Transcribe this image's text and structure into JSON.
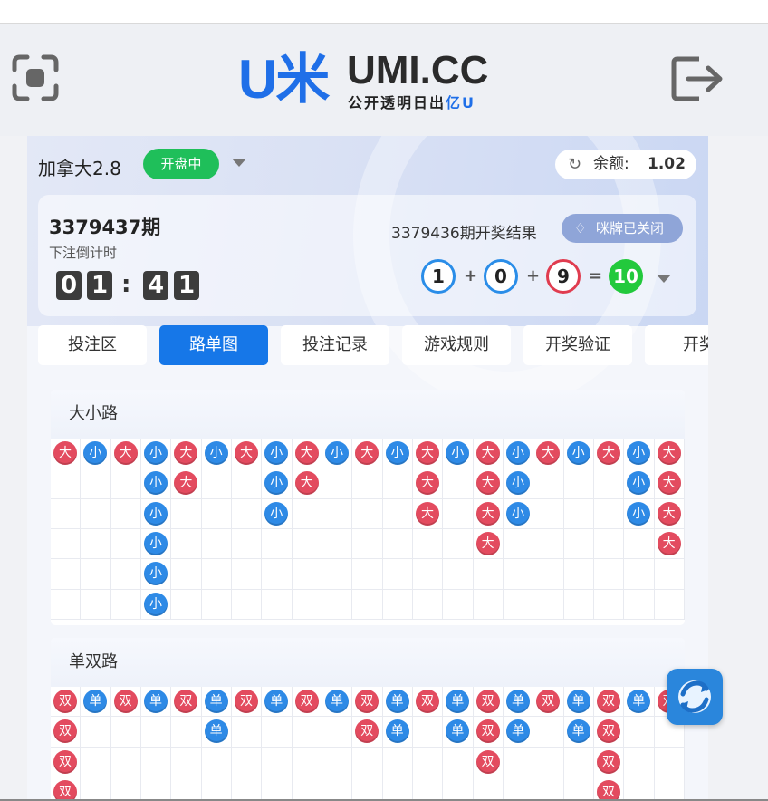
{
  "logo": {
    "mark": "U米",
    "name": "UMI.CC",
    "slogan_main": "公开透明日出",
    "slogan_tail": "亿U"
  },
  "game": {
    "name": "加拿大2.8",
    "status": "开盘中"
  },
  "balance": {
    "label": "余额:",
    "value": "1.02"
  },
  "draw": {
    "current_period": "3379437期",
    "countdown_label": "下注倒计时",
    "countdown_digits": [
      "0",
      "1",
      "4",
      "1"
    ],
    "countdown_sep": ":",
    "last_result_label": "3379436期开奖结果",
    "squeeze_label": "咪牌已关闭",
    "balls": [
      "1",
      "0",
      "9"
    ],
    "sum": "10",
    "ops": [
      "+",
      "+",
      "="
    ]
  },
  "tabs": [
    {
      "label": "投注区",
      "active": false
    },
    {
      "label": "路单图",
      "active": true
    },
    {
      "label": "投注记录",
      "active": false
    },
    {
      "label": "游戏规则",
      "active": false
    },
    {
      "label": "开奖验证",
      "active": false
    },
    {
      "label": "开奖",
      "active": false
    }
  ],
  "colors": {
    "accent": "#1677e8",
    "big_even": "#e34b5f",
    "small_odd": "#2e8ae6",
    "open": "#1fbf5a",
    "sum": "#22c93c"
  },
  "roads": [
    {
      "title": "大小路",
      "rows": 6,
      "columns": [
        [
          "大"
        ],
        [
          "小"
        ],
        [
          "大"
        ],
        [
          "小",
          "小",
          "小",
          "小",
          "小",
          "小"
        ],
        [
          "大",
          "大"
        ],
        [
          "小"
        ],
        [
          "大"
        ],
        [
          "小",
          "小",
          "小"
        ],
        [
          "大",
          "大"
        ],
        [
          "小"
        ],
        [
          "大"
        ],
        [
          "小"
        ],
        [
          "大",
          "大",
          "大"
        ],
        [
          "小"
        ],
        [
          "大",
          "大",
          "大",
          "大"
        ],
        [
          "小",
          "小",
          "小"
        ],
        [
          "大"
        ],
        [
          "小"
        ],
        [
          "大"
        ],
        [
          "小",
          "小",
          "小"
        ],
        [
          "大",
          "大",
          "大",
          "大"
        ]
      ]
    },
    {
      "title": "单双路",
      "rows": 4,
      "columns": [
        [
          "双",
          "双",
          "双",
          "双"
        ],
        [
          "单"
        ],
        [
          "双"
        ],
        [
          "单"
        ],
        [
          "双"
        ],
        [
          "单",
          "单"
        ],
        [
          "双"
        ],
        [
          "单"
        ],
        [
          "双"
        ],
        [
          "单"
        ],
        [
          "双",
          "双"
        ],
        [
          "单",
          "单"
        ],
        [
          "双"
        ],
        [
          "单",
          "单"
        ],
        [
          "双",
          "双",
          "双"
        ],
        [
          "单",
          "单"
        ],
        [
          "双"
        ],
        [
          "单",
          "单"
        ],
        [
          "双",
          "双",
          "双",
          "双"
        ],
        [
          "单"
        ],
        [
          "双"
        ]
      ]
    }
  ]
}
